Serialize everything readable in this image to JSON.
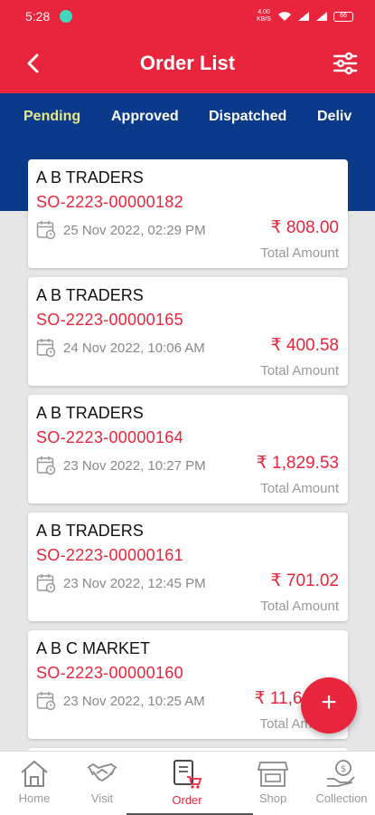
{
  "status_bar": {
    "time": "5:28",
    "network": "4.00 KB/S",
    "battery": "66"
  },
  "app_bar": {
    "title": "Order List",
    "back_icon": "chevron-left-icon",
    "filter_icon": "sliders-icon"
  },
  "tabs": [
    {
      "label": "Pending",
      "active": true
    },
    {
      "label": "Approved",
      "active": false
    },
    {
      "label": "Dispatched",
      "active": false
    },
    {
      "label": "Deliv",
      "active": false
    }
  ],
  "orders": [
    {
      "customer": "A B TRADERS",
      "order_no": "SO-2223-00000182",
      "date": "25 Nov 2022, 02:29 PM",
      "amount": "₹ 808.00",
      "amount_label": "Total Amount"
    },
    {
      "customer": "A B TRADERS",
      "order_no": "SO-2223-00000165",
      "date": "24 Nov 2022, 10:06 AM",
      "amount": "₹ 400.58",
      "amount_label": "Total Amount"
    },
    {
      "customer": "A B TRADERS",
      "order_no": "SO-2223-00000164",
      "date": "23 Nov 2022, 10:27 PM",
      "amount": "₹ 1,829.53",
      "amount_label": "Total Amount"
    },
    {
      "customer": "A B TRADERS",
      "order_no": "SO-2223-00000161",
      "date": "23 Nov 2022, 12:45 PM",
      "amount": "₹ 701.02",
      "amount_label": "Total Amount"
    },
    {
      "customer": "A B C MARKET",
      "order_no": "SO-2223-00000160",
      "date": "23 Nov 2022, 10:25 AM",
      "amount": "₹ 11,61",
      "amount_label": "Total Am"
    }
  ],
  "fab": {
    "label": "+"
  },
  "bottom_nav": [
    {
      "label": "Home",
      "icon": "home-icon"
    },
    {
      "label": "Visit",
      "icon": "handshake-icon"
    },
    {
      "label": "Order",
      "icon": "order-cart-icon",
      "active": true
    },
    {
      "label": "Shop",
      "icon": "shop-icon"
    },
    {
      "label": "Collection",
      "icon": "money-hand-icon"
    }
  ],
  "colors": {
    "primary_red": "#e8253c",
    "tab_blue": "#0c3a8a",
    "active_tab_text": "#e5e98a",
    "background": "#e6e6e6"
  }
}
